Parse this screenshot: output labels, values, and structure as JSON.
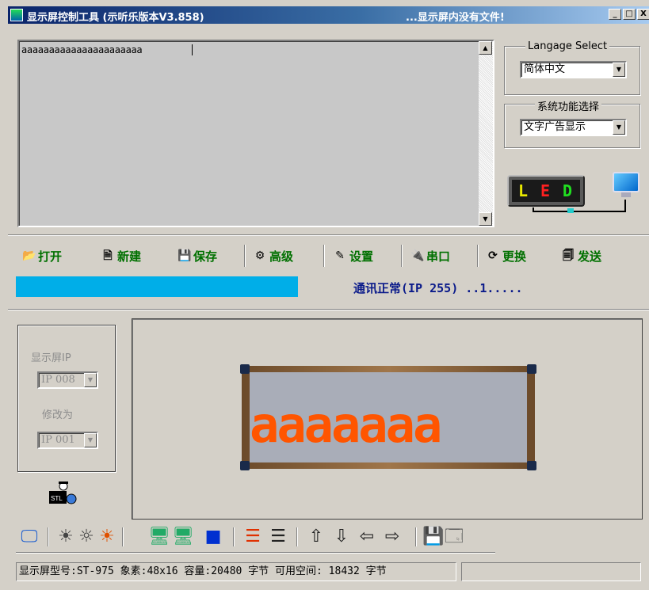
{
  "window": {
    "title": "显示屏控制工具 (示听乐版本V3.858)",
    "status": "...显示屏内没有文件!",
    "minimize_label": "_",
    "maximize_label": "□",
    "close_label": "X"
  },
  "editor": {
    "content": "aaaaaaaaaaaaaaaaaaaaaa",
    "scroll_up": "▲",
    "scroll_down": "▼"
  },
  "language": {
    "legend": "Langage Select",
    "selected": "简体中文"
  },
  "function_select": {
    "legend": "系统功能选择",
    "selected": "文字广告显示"
  },
  "led_logo": {
    "letters": [
      {
        "char": "L",
        "color": "#e8e800"
      },
      {
        "char": "E",
        "color": "#ff2020"
      },
      {
        "char": "D",
        "color": "#20e020"
      }
    ]
  },
  "toolbar": {
    "items": [
      {
        "name": "open-button",
        "icon": "folder-open-icon",
        "glyph": "📂",
        "label": "打开"
      },
      {
        "name": "new-button",
        "icon": "new-document-icon",
        "glyph": "🗎",
        "label": "新建"
      },
      {
        "name": "save-button",
        "icon": "floppy-icon",
        "glyph": "💾",
        "label": "保存"
      },
      {
        "name": "advanced-button",
        "icon": "advanced-icon",
        "glyph": "⚙",
        "label": "高级"
      },
      {
        "name": "settings-button",
        "icon": "pencil-icon",
        "glyph": "✎",
        "label": "设置"
      },
      {
        "name": "serial-port-button",
        "icon": "plug-icon",
        "glyph": "🔌",
        "label": "串口"
      },
      {
        "name": "switch-button",
        "icon": "switch-icon",
        "glyph": "⟳",
        "label": "更换"
      },
      {
        "name": "send-button",
        "icon": "send-icon",
        "glyph": "🗐",
        "label": "发送"
      }
    ]
  },
  "progress": {
    "percent": 100,
    "color": "#00aee8"
  },
  "comm_status": "通讯正常(IP 255) ..1.....",
  "ip_panel": {
    "ip_label": "显示屏IP",
    "ip_value": "IP 008",
    "change_label": "修改为",
    "change_value": "IP 001"
  },
  "preview": {
    "led_text": "aaaaaaa",
    "led_color": "#ff5500",
    "screen_color": "#a9adb8"
  },
  "bottom_tools": [
    {
      "name": "screen-color-icon",
      "glyph": "🖵",
      "color": "#1a5ccf"
    },
    {
      "name": "bulb-off-icon",
      "glyph": "☀",
      "color": "#444"
    },
    {
      "name": "bulb-dim-icon",
      "glyph": "☼",
      "color": "#444"
    },
    {
      "name": "bulb-on-icon",
      "glyph": "☀",
      "color": "#e05000"
    },
    {
      "name": "computer-icon",
      "glyph": "🖥",
      "color": "#2a6"
    },
    {
      "name": "computer-sync-icon",
      "glyph": "🖥",
      "color": "#2a6"
    },
    {
      "name": "blue-square-icon",
      "glyph": "■",
      "color": "#0030d0"
    },
    {
      "name": "align-lines-red-icon",
      "glyph": "☰",
      "color": "#e03000"
    },
    {
      "name": "align-lines-icon",
      "glyph": "☰",
      "color": "#222"
    },
    {
      "name": "arrow-up-icon",
      "glyph": "⇧",
      "color": "#222"
    },
    {
      "name": "arrow-down-icon",
      "glyph": "⇩",
      "color": "#222"
    },
    {
      "name": "arrow-left-icon",
      "glyph": "⇦",
      "color": "#222"
    },
    {
      "name": "arrow-right-icon",
      "glyph": "⇨",
      "color": "#222"
    },
    {
      "name": "save-bmp-icon",
      "glyph": "💾",
      "color": "#060"
    },
    {
      "name": "bmp-file-icon",
      "glyph": "🗔",
      "color": "#555"
    }
  ],
  "statusbar": {
    "info": "显示屏型号:ST-975  象素:48x16  容量:20480 字节 可用空间: 18432 字节",
    "extra": ""
  }
}
